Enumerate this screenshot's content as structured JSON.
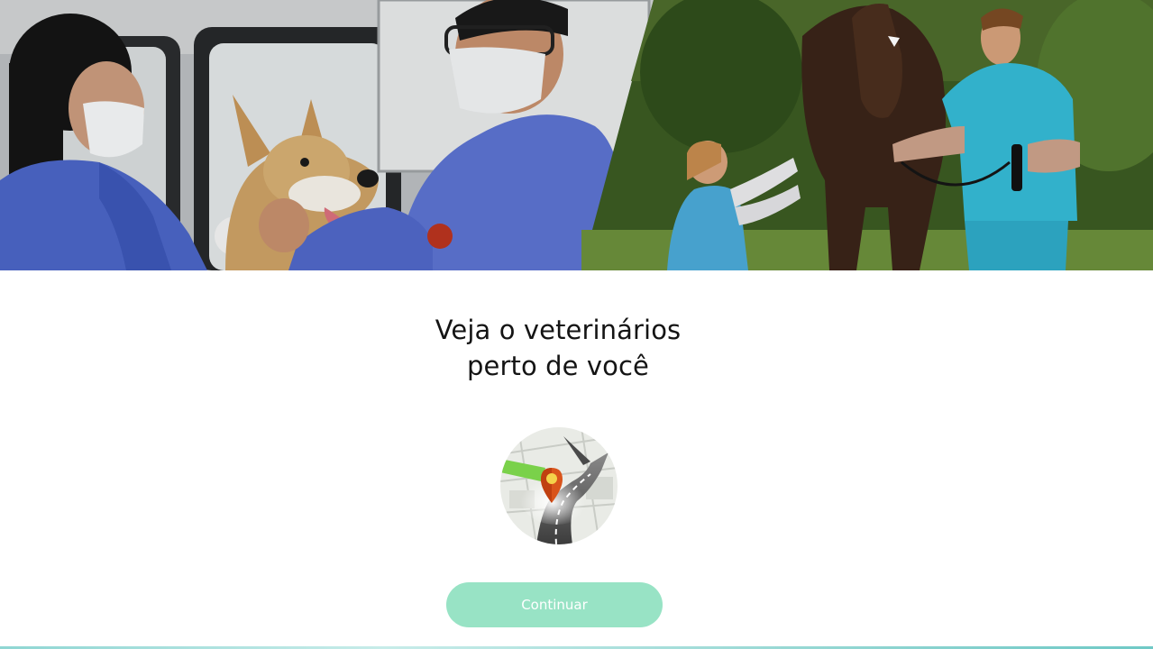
{
  "hero": {
    "image_left": "veterinarians-examining-dog",
    "image_right": "veterinarians-examining-horse"
  },
  "headline": {
    "line1": "Veja o veterinários",
    "line2": "perto de você"
  },
  "map_icon": "map-location-pin-icon",
  "continue_button": {
    "label": "Continuar"
  },
  "colors": {
    "button_bg": "#98e3c5",
    "button_text": "#ffffff",
    "headline": "#141414",
    "bottom_strip": "#8fd6d3"
  }
}
